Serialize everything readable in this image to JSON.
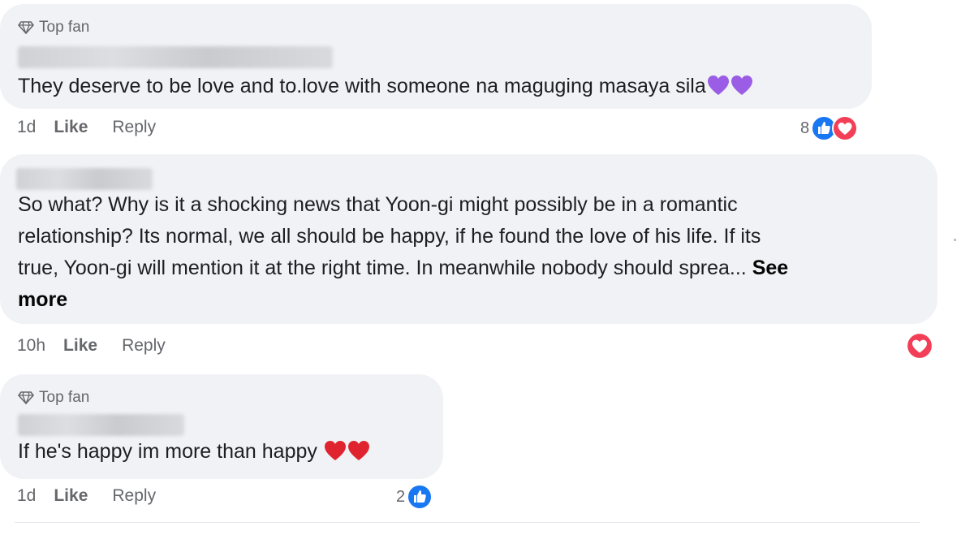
{
  "comments": [
    {
      "badge": "Top fan",
      "text": "They deserve to be love and to.love with someone na maguging masaya sila",
      "emoji": [
        "purple-heart",
        "purple-heart"
      ],
      "time": "1d",
      "like_label": "Like",
      "reply_label": "Reply",
      "reaction_count": "8",
      "reaction_types": [
        "like",
        "love"
      ]
    },
    {
      "badge": "",
      "lines": [
        "So what? Why is it a shocking news that Yoon-gi might possibly be in a romantic",
        "relationship? Its normal, we all should be happy, if he found the love of his life. If its",
        "true, Yoon-gi will mention it at the right time. In meanwhile nobody should sprea..."
      ],
      "see_more_part1": "See",
      "see_more_part2": "more",
      "time": "10h",
      "like_label": "Like",
      "reply_label": "Reply",
      "reaction_count": "",
      "reaction_types": [
        "love"
      ]
    },
    {
      "badge": "Top fan",
      "text": "If he's happy im more than happy",
      "emoji": [
        "red-heart",
        "red-heart"
      ],
      "time": "1d",
      "like_label": "Like",
      "reply_label": "Reply",
      "reaction_count": "2",
      "reaction_types": [
        "like"
      ]
    }
  ],
  "colors": {
    "bubble": "#f0f2f5",
    "meta_text": "#65676b",
    "like_blue": "#1877f2",
    "love_red": "#f33e58",
    "purple_heart": "#9b5de5",
    "red_heart": "#e0242f"
  }
}
